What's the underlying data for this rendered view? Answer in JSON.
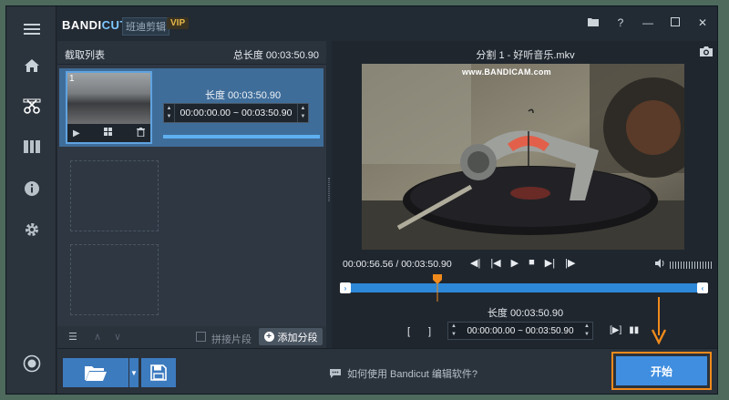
{
  "app": {
    "logo_main": "BANDI",
    "logo_accent": "CUT",
    "subtitle": "班迪剪辑",
    "vip_badge": "VIP"
  },
  "window_controls": [
    "folder-icon",
    "help-icon",
    "minimize-icon",
    "maximize-icon",
    "close-icon"
  ],
  "rail": [
    "menu-icon",
    "home-icon",
    "cut-icon",
    "merge-icon",
    "info-icon",
    "settings-icon",
    "record-icon"
  ],
  "clip_list": {
    "header_title": "截取列表",
    "total_label": "总长度 00:03:50.90",
    "clip": {
      "number": "1",
      "length_label": "长度 00:03:50.90",
      "range": "00:00:00.00 ~ 00:03:50.90"
    },
    "footer": {
      "join_label": "拼接片段",
      "add_label": "添加分段"
    }
  },
  "preview": {
    "title": "分割 1 - 好听音乐.mkv",
    "watermark": "www.BANDICAM.com",
    "current_time": "00:00:56.56 / 00:03:50.90",
    "length_label": "长度 00:03:50.90",
    "range": "00:00:00.00 ~ 00:03:50.90",
    "bracket_open": "[",
    "bracket_close": "]"
  },
  "bottom": {
    "help_text": "如何使用 Bandicut 编辑软件?",
    "start_label": "开始"
  },
  "colors": {
    "accent_blue": "#3f8ee0",
    "highlight_orange": "#f08a1c",
    "timeline_blue": "#2e88d8"
  }
}
